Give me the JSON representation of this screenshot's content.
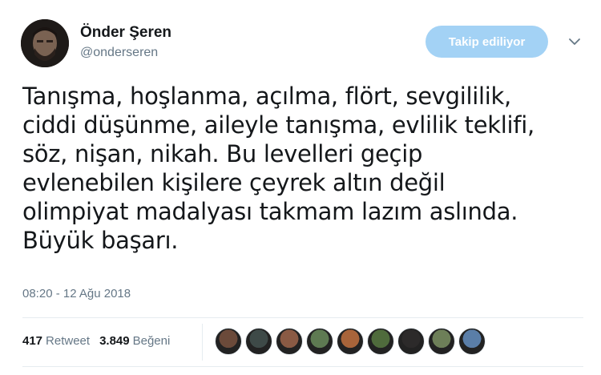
{
  "author": {
    "display_name": "Önder Şeren",
    "handle": "@onderseren"
  },
  "follow_button": {
    "label": "Takip ediliyor"
  },
  "tweet": {
    "text": "Tanışma, hoşlanma, açılma, flört, sevgililik,\nciddi düşünme, aileyle tanışma, evlilik teklifi,\nsöz, nişan, nikah. Bu levelleri geçip\nevlenebilen kişilere çeyrek altın değil\nolimpiyat madalyası takmam lazım aslında.\nBüyük başarı.",
    "timestamp": "08:20 - 12 Ağu 2018"
  },
  "stats": {
    "retweets_count": "417",
    "retweets_label": "Retweet",
    "likes_count": "3.849",
    "likes_label": "Beğeni"
  },
  "likers": [
    {
      "color": "#6b4a3a"
    },
    {
      "color": "#3e4a48"
    },
    {
      "color": "#8a5a44"
    },
    {
      "color": "#5e7a52"
    },
    {
      "color": "#a8643a"
    },
    {
      "color": "#4f6b3c"
    },
    {
      "color": "#2c2a2a"
    },
    {
      "color": "#6d7f58"
    },
    {
      "color": "#5a7ea8"
    }
  ],
  "colors": {
    "accent": "#1da1f2",
    "follow_button_bg": "#a3d2f5",
    "muted_text": "#657786"
  }
}
